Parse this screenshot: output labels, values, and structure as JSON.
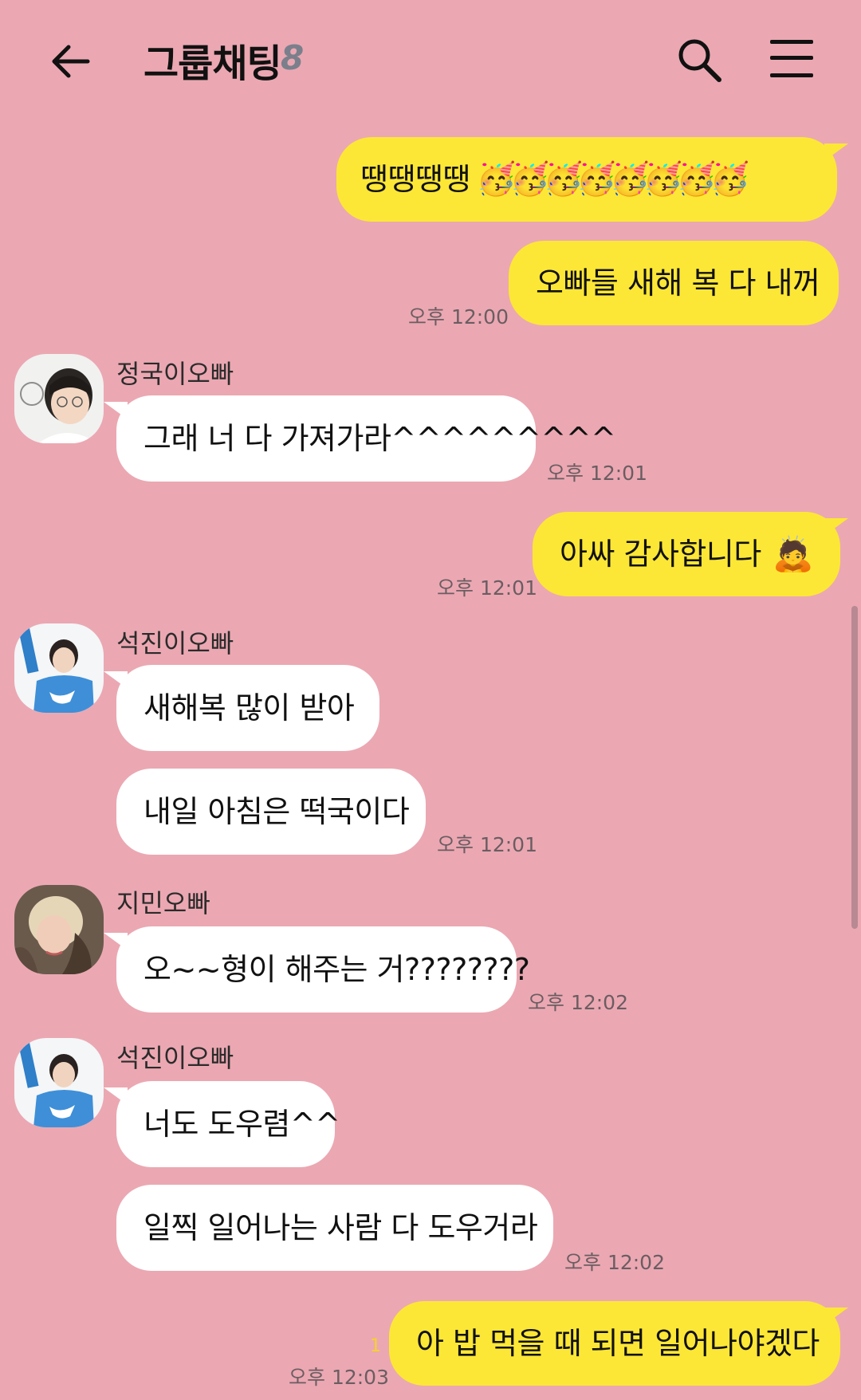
{
  "header": {
    "title": "그룹채팅",
    "member_count": "8"
  },
  "messages": [
    {
      "from": "me",
      "text": "땡땡땡땡",
      "emoji": "🥳🥳🥳🥳🥳🥳🥳🥳"
    },
    {
      "from": "me",
      "text": "오빠들 새해 복 다 내꺼",
      "time": "오후 12:00"
    },
    {
      "from": "정국이오빠",
      "text": "그래 너 다 가져가라^^^^^^^^^",
      "time": "오후 12:01"
    },
    {
      "from": "me",
      "text": "아싸 감사합니다",
      "emoji": "🙇",
      "time": "오후 12:01"
    },
    {
      "from": "석진이오빠",
      "text": "새해복 많이 받아"
    },
    {
      "from": "석진이오빠",
      "text": "내일 아침은 떡국이다",
      "time": "오후 12:01"
    },
    {
      "from": "지민오빠",
      "text": "오~~형이 해주는 거????????",
      "time": "오후 12:02"
    },
    {
      "from": "석진이오빠",
      "text": "너도 도우렴^^"
    },
    {
      "from": "석진이오빠",
      "text": "일찍 일어나는 사람 다 도우거라",
      "time": "오후 12:02"
    },
    {
      "from": "me",
      "text": "아 밥 먹을 때 되면 일어나야겠다",
      "time": "오후 12:03",
      "unread": "1"
    }
  ],
  "senders": {
    "jungkook": "정국이오빠",
    "seokjin": "석진이오빠",
    "jimin": "지민오빠"
  },
  "colors": {
    "background": "#eba8b2",
    "my_bubble": "#fde736",
    "other_bubble": "#ffffff"
  }
}
